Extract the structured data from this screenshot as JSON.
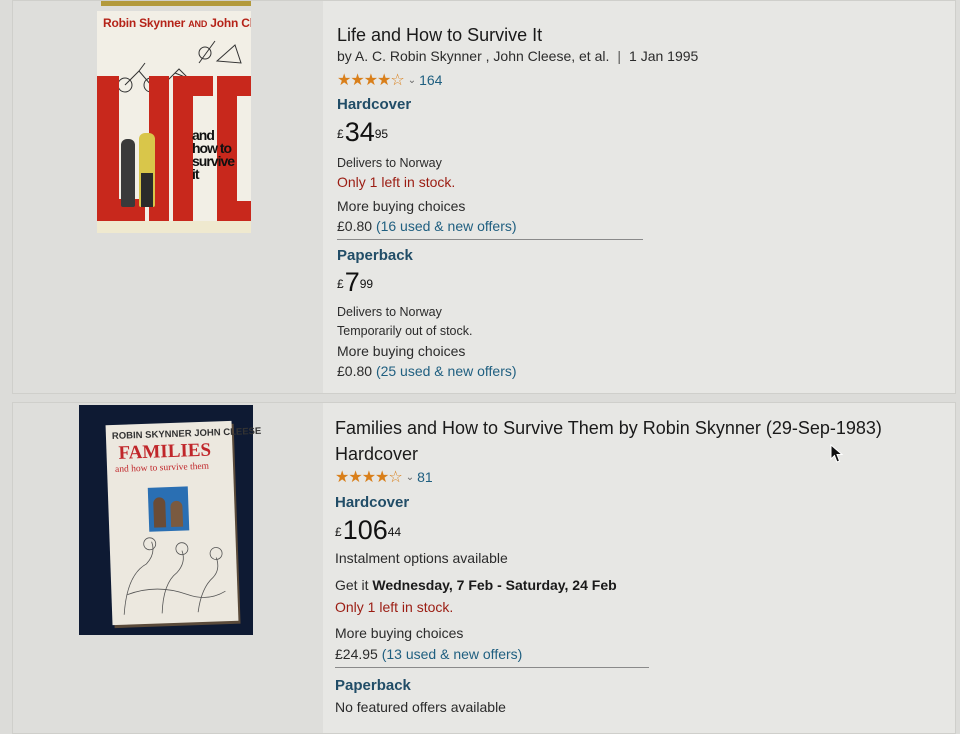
{
  "results": [
    {
      "title": "Life and How to Survive It",
      "byline": "by A. C. Robin Skynner , John Cleese, et al.",
      "date": "1 Jan 1995",
      "rating_stars": "★★★★☆",
      "rating_value": 4.5,
      "rating_count": "164",
      "cover_authors": "Robin Skynner",
      "cover_and": "AND",
      "cover_author2": "John Cleese",
      "cover_subtitle": "and how to survive it",
      "formats": [
        {
          "name": "Hardcover",
          "currency": "£",
          "price_whole": "34",
          "price_fraction": "95",
          "delivery": "Delivers to Norway",
          "stock": "Only 1 left in stock.",
          "more_choices": "More buying choices",
          "offer_price": "£0.80",
          "offer_link": "(16 used & new offers)"
        },
        {
          "name": "Paperback",
          "currency": "£",
          "price_whole": "7",
          "price_fraction": "99",
          "delivery": "Delivers to Norway",
          "stock": "Temporarily out of stock.",
          "more_choices": "More buying choices",
          "offer_price": "£0.80",
          "offer_link": "(25 used & new offers)"
        }
      ]
    },
    {
      "title_line1": "Families and How to Survive Them by Robin Skynner (29-Sep-1983)",
      "title_line2": "Hardcover",
      "rating_stars": "★★★★☆",
      "rating_value": 4.5,
      "rating_count": "81",
      "cover_authors": "ROBIN SKYNNER JOHN CLEESE",
      "cover_title": "FAMILIES",
      "cover_subtitle": "and how to survive them",
      "formats": [
        {
          "name": "Hardcover",
          "currency": "£",
          "price_whole": "106",
          "price_fraction": "44",
          "instalment": "Instalment options available",
          "get_it_prefix": "Get it",
          "get_it_dates": "Wednesday, 7 Feb - Saturday, 24 Feb",
          "stock": "Only 1 left in stock.",
          "more_choices": "More buying choices",
          "offer_price": "£24.95",
          "offer_link": "(13 used & new offers)"
        },
        {
          "name": "Paperback",
          "no_offers": "No featured offers available"
        }
      ]
    }
  ],
  "colors": {
    "star": "#d97f1a",
    "link": "#1f5f80",
    "format_heading": "#214d67",
    "stock_warning": "#9b1c12"
  },
  "icons": [
    "star-rating-icon",
    "chevron-down-icon",
    "mouse-cursor-icon"
  ]
}
